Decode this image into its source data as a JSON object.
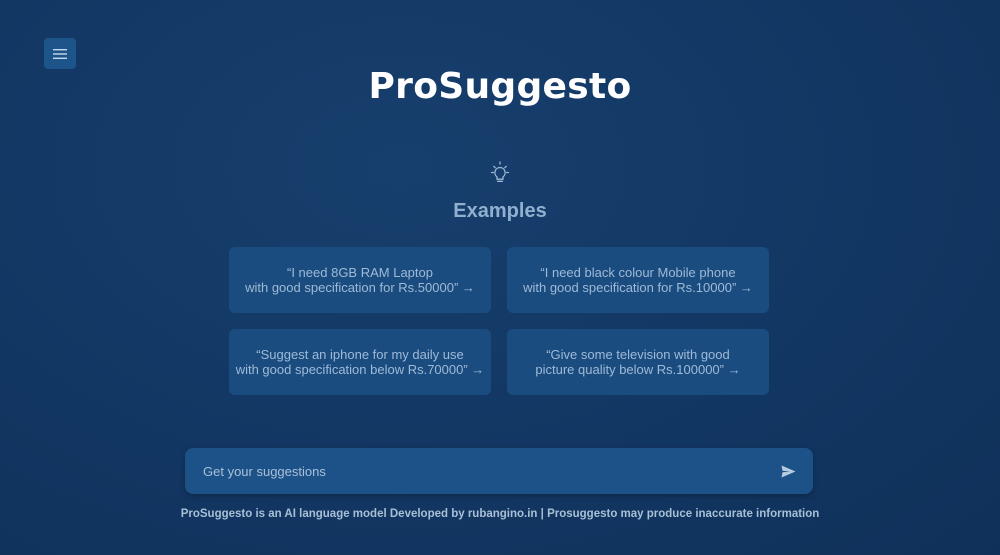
{
  "app": {
    "title": "ProSuggesto"
  },
  "menu": {
    "icon": "hamburger-menu-icon"
  },
  "examples": {
    "icon": "lightbulb-icon",
    "heading": "Examples",
    "cards": [
      {
        "text": "“I need 8GB RAM Laptop\nwith good specification for Rs.50000” →"
      },
      {
        "text": "“I need black colour Mobile phone\nwith good specification for Rs.10000” →"
      },
      {
        "text": "“Suggest an iphone for my daily use\nwith good specification below Rs.70000” →"
      },
      {
        "text": "“Give some television  with good\npicture quality below Rs.100000” →"
      }
    ]
  },
  "search": {
    "placeholder": "Get your suggestions",
    "value": "",
    "send_icon": "send-icon"
  },
  "footer": {
    "text": "ProSuggesto is an AI language model Developed by rubangino.in | Prosuggesto may produce inaccurate information"
  },
  "colors": {
    "background": "#133865",
    "card": "#1a4c80",
    "input": "#1d5288",
    "muted_text": "#8fb0cf"
  }
}
